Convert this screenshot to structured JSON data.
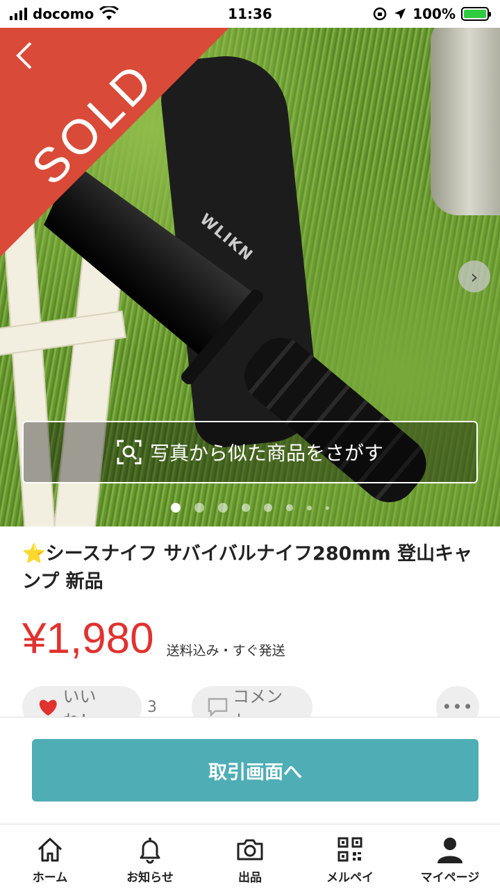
{
  "status_bar": {
    "carrier": "docomo",
    "time": "11:36",
    "battery": "100%"
  },
  "hero": {
    "sold_label": "SOLD",
    "blade_brand": "WLIKN",
    "search_similar_label": "写真から似た商品をさがす",
    "total_images": 8,
    "active_image_index": 0
  },
  "product": {
    "title_icon": "star-emoji",
    "title": "シースナイフ サバイバルナイフ280mm 登山キャンプ 新品",
    "price": "¥1,980",
    "shipping_note": "送料込み・すぐ発送"
  },
  "actions": {
    "like_label": "いいね！",
    "like_count": "3",
    "comment_label": "コメント"
  },
  "trade_button_label": "取引画面へ",
  "tabs": [
    {
      "label": "ホーム",
      "icon": "home-icon"
    },
    {
      "label": "お知らせ",
      "icon": "bell-icon"
    },
    {
      "label": "出品",
      "icon": "camera-icon"
    },
    {
      "label": "メルペイ",
      "icon": "qr-code-icon"
    },
    {
      "label": "マイページ",
      "icon": "person-icon"
    }
  ],
  "colors": {
    "sold_ribbon": "#d94a39",
    "price": "#e0322e",
    "trade_button": "#4fadb5",
    "battery_fill": "#2ecc40"
  }
}
